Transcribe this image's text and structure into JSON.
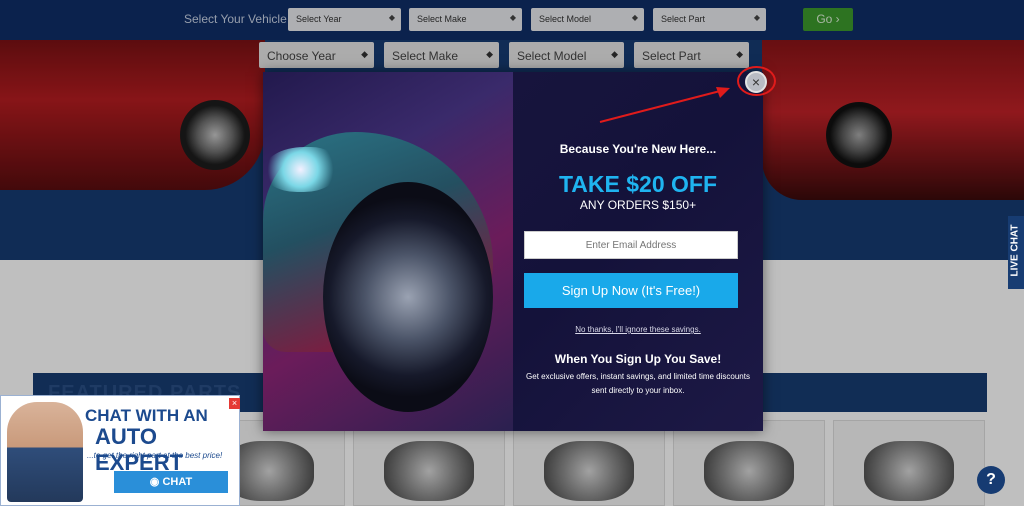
{
  "topbar": {
    "label": "Select Your Vehicle",
    "selects": [
      "Select Year",
      "Select Make",
      "Select Model",
      "Select Part"
    ],
    "go_label": "Go ›"
  },
  "hero": {
    "selects": [
      "Choose Year",
      "Select Make",
      "Select Model",
      "Select Part"
    ]
  },
  "featured": {
    "title": "FEATURED PARTS"
  },
  "livechat": {
    "label": "LIVE CHAT"
  },
  "help": {
    "label": "?"
  },
  "chat_widget": {
    "line1": "CHAT WITH AN",
    "line2": "AUTO EXPERT",
    "line3": "...to get the right part at the best price!",
    "button": "CHAT",
    "close": "×"
  },
  "modal": {
    "intro": "Because You're New Here...",
    "offer": "TAKE $20 OFF",
    "sub": "ANY ORDERS $150+",
    "email_placeholder": "Enter Email Address",
    "signup": "Sign Up Now (It's Free!)",
    "no_thanks": "No thanks, I'll ignore these savings.",
    "save_title": "When You Sign Up You Save!",
    "save_desc": "Get exclusive offers, instant savings, and limited time discounts sent directly to your inbox.",
    "close": "×"
  },
  "colors": {
    "nav": "#0f2e67",
    "accent": "#19a9ea",
    "offer": "#1fb4f0",
    "go": "#3d9a2d",
    "annotation": "#e01b1b"
  }
}
